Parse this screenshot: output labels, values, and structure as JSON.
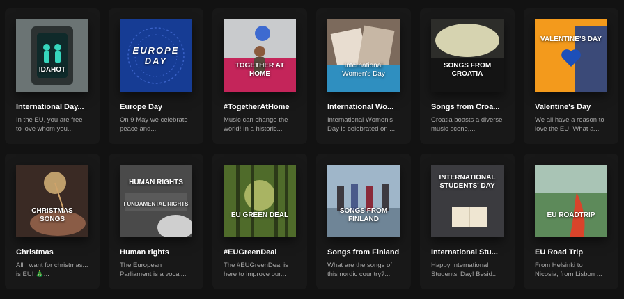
{
  "playlists": [
    {
      "title": "International Day...",
      "description": "In the EU, you are free to love whom you...",
      "cover_text": "IDAHOT",
      "cover_bg": "#5f6a6a",
      "cover_accent": "#2aa79a",
      "icon": "traffic-light-icon"
    },
    {
      "title": "Europe Day",
      "description": "On 9 May we celebrate peace and...",
      "cover_text": "EUROPE DAY",
      "cover_subtext": "#EUROPEDAY",
      "cover_bg": "#163c94",
      "cover_accent": "#3a62c8",
      "icon": "europe-day-logo-icon"
    },
    {
      "title": "#TogetherAtHome",
      "description": "Music can change the world! In a historic...",
      "cover_text": "TOGETHER AT HOME",
      "cover_bg": "#c9cbcd",
      "cover_accent": "#c4255a",
      "icon": "child-with-ball-icon"
    },
    {
      "title": "International Wo...",
      "description": "International Women's Day is celebrated on ...",
      "cover_text": "International Women's Day",
      "cover_bg": "#7c6a5c",
      "cover_accent": "#e8ddd0",
      "icon": "magazines-icon"
    },
    {
      "title": "Songs from Croa...",
      "description": "Croatia boasts a diverse music scene,...",
      "cover_text": "SONGS FROM CROATIA",
      "cover_bg": "#2d2d2a",
      "cover_accent": "#f5f1c8",
      "icon": "concert-crowd-icon"
    },
    {
      "title": "Valentine's Day",
      "description": "We all have a reason to love the EU. What a...",
      "cover_text": "VALENTINE'S DAY",
      "cover_bg": "#f39a1c",
      "cover_accent": "#1d4fb8",
      "icon": "heart-icon"
    },
    {
      "title": "Christmas",
      "description": "All I want for christmas... is EU! 🎄...",
      "cover_text": "CHRISTMAS SONGS",
      "cover_bg": "#3a2a24",
      "cover_accent": "#f7d08a",
      "icon": "sparkler-icon"
    },
    {
      "title": "Human rights",
      "description": "The European Parliament is a vocal...",
      "cover_text": "HUMAN RIGHTS",
      "cover_subtext": "FUNDAMENTAL RIGHTS",
      "cover_bg": "#4a4a4a",
      "cover_accent": "#cfcfcf",
      "icon": "human-rights-icon"
    },
    {
      "title": "#EUGreenDeal",
      "description": "The #EUGreenDeal is here to improve our...",
      "cover_text": "EU GREEN DEAL",
      "cover_bg": "#4f6b2a",
      "cover_accent": "#e6e58a",
      "icon": "forest-icon"
    },
    {
      "title": "Songs from Finland",
      "description": "What are the songs of this nordic country?...",
      "cover_text": "SONGS FROM FINLAND",
      "cover_bg": "#9fb6c9",
      "cover_accent": "#3d3a40",
      "icon": "band-icon"
    },
    {
      "title": "International Stu...",
      "description": "Happy International Students' Day! Besid...",
      "cover_text": "INTERNATIONAL STUDENTS' DAY",
      "cover_bg": "#3b3b3f",
      "cover_accent": "#efe6d2",
      "icon": "book-icon"
    },
    {
      "title": "EU Road Trip",
      "description": "From Helsinki to Nicosia, from Lisbon ...",
      "cover_text": "EU ROADTRIP",
      "cover_bg": "#5d8a5a",
      "cover_accent": "#d9442b",
      "icon": "road-trip-icon"
    }
  ]
}
